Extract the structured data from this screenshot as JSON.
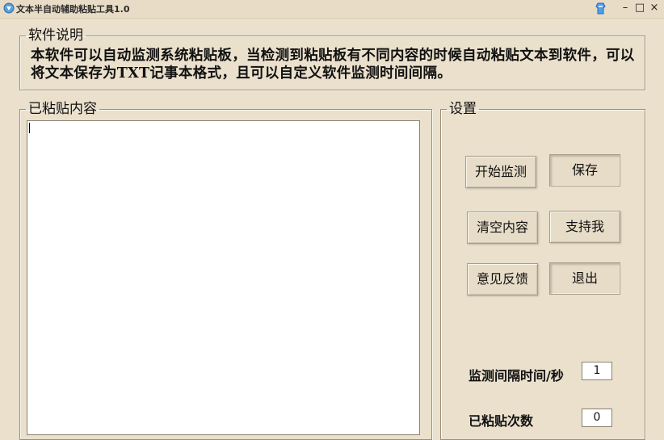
{
  "window": {
    "title": "文本半自动辅助粘贴工具1.0",
    "minimize_glyph": "–",
    "maximize_glyph": "□",
    "close_glyph": "×",
    "icons": {
      "app": "app-icon",
      "skin": "skin-icon"
    }
  },
  "description": {
    "legend": "软件说明",
    "text": "本软件可以自动监测系统粘贴板，当检测到粘贴板有不同内容的时候自动粘贴文本到软件，可以将文本保存为TXT记事本格式，且可以自定义软件监测时间间隔。"
  },
  "pasted": {
    "legend": "已粘贴内容",
    "content": ""
  },
  "settings": {
    "legend": "设置",
    "buttons": {
      "start": "开始监测",
      "save": "保存",
      "clear": "清空内容",
      "support": "支持我",
      "feedback": "意见反馈",
      "exit": "退出"
    },
    "interval_label": "监测间隔时间/秒",
    "interval_value": "1",
    "count_label": "已粘贴次数",
    "count_value": "0"
  },
  "colors": {
    "background": "#eae0cc",
    "button_face": "#e6dcc7",
    "border": "#9a8f7c"
  }
}
